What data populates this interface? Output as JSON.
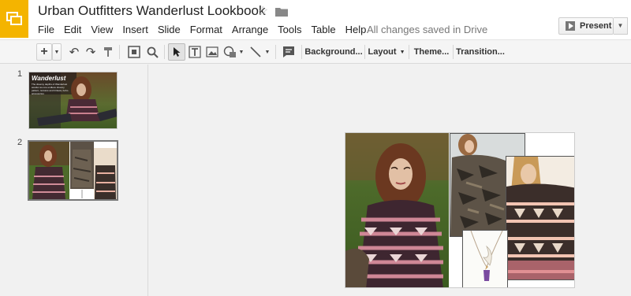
{
  "header": {
    "doc_title": "Urban Outfitters Wanderlust Lookbook",
    "save_status": "All changes saved in Drive",
    "present_label": "Present"
  },
  "menu": [
    "File",
    "Edit",
    "View",
    "Insert",
    "Slide",
    "Format",
    "Arrange",
    "Tools",
    "Table",
    "Help"
  ],
  "toolbar": {
    "background_label": "Background...",
    "layout_label": "Layout",
    "theme_label": "Theme...",
    "transition_label": "Transition..."
  },
  "filmstrip": {
    "slides": [
      {
        "number": "1",
        "title": "Wanderlust",
        "caption": "The dreamy depths of Wanderlust wander as one endless dreamy pattern, textures and trinkets, boho accessories"
      },
      {
        "number": "2"
      }
    ]
  },
  "colors": {
    "logo": "#f4b400",
    "filmstrip_bg": "#f1f1f1",
    "canvas_bg": "#f1f1f1",
    "selected_slide_border": "#777777"
  }
}
